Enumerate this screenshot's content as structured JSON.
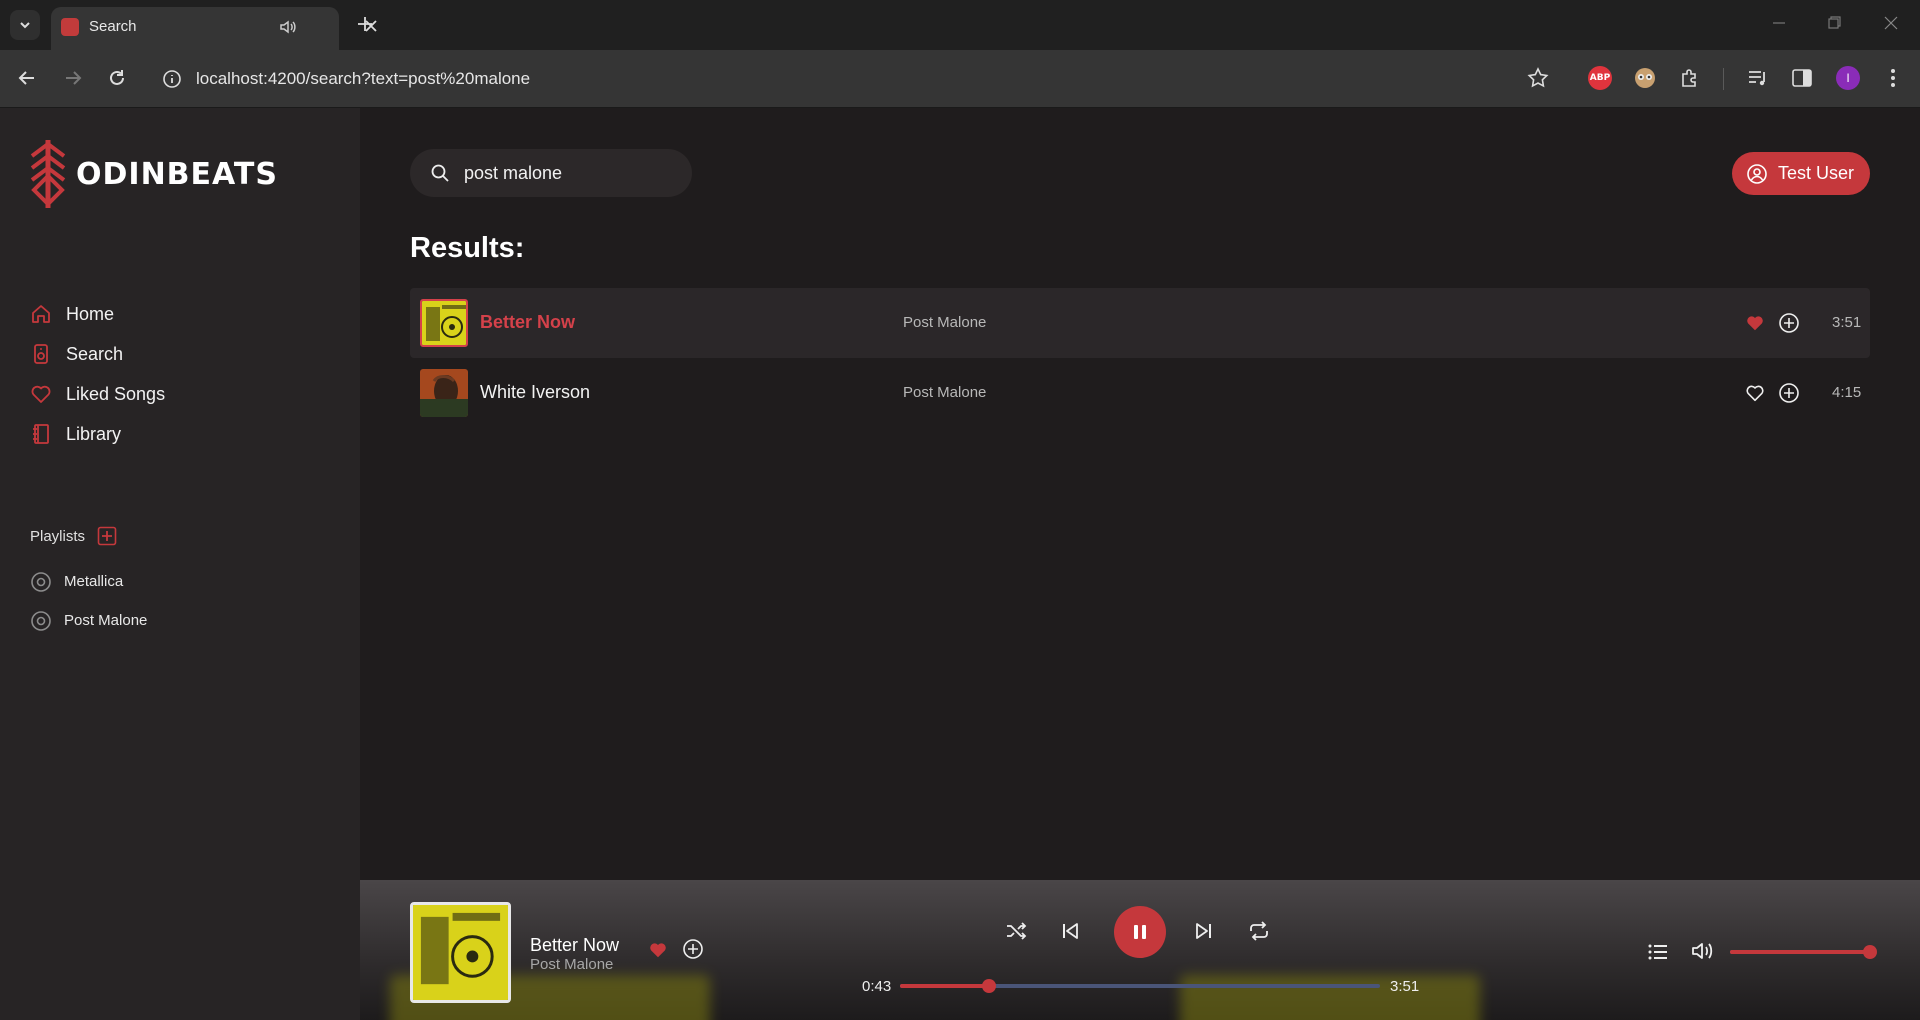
{
  "browser": {
    "tab_title": "Search",
    "url": "localhost:4200/search?text=post%20malone",
    "profile_initial": "I",
    "abp_label": "ABP"
  },
  "app": {
    "brand": "ODINBEATS",
    "accent_color": "#c5383c"
  },
  "sidebar": {
    "nav": [
      {
        "label": "Home",
        "icon": "home-icon"
      },
      {
        "label": "Search",
        "icon": "speaker-icon"
      },
      {
        "label": "Liked Songs",
        "icon": "heart-icon"
      },
      {
        "label": "Library",
        "icon": "library-icon"
      }
    ],
    "playlists_label": "Playlists",
    "playlists": [
      {
        "name": "Metallica",
        "icon": "disc-icon"
      },
      {
        "name": "Post Malone",
        "icon": "disc-icon"
      }
    ]
  },
  "main": {
    "search_value": "post malone",
    "user_label": "Test User",
    "results_title": "Results:",
    "results": [
      {
        "title": "Better Now",
        "artist": "Post Malone",
        "duration": "3:51",
        "liked": true,
        "playing": true
      },
      {
        "title": "White Iverson",
        "artist": "Post Malone",
        "duration": "4:15",
        "liked": false,
        "playing": false
      }
    ]
  },
  "player": {
    "title": "Better Now",
    "artist": "Post Malone",
    "current_time": "0:43",
    "total_time": "3:51",
    "progress": 0.186,
    "volume": 1.0,
    "liked": true
  }
}
